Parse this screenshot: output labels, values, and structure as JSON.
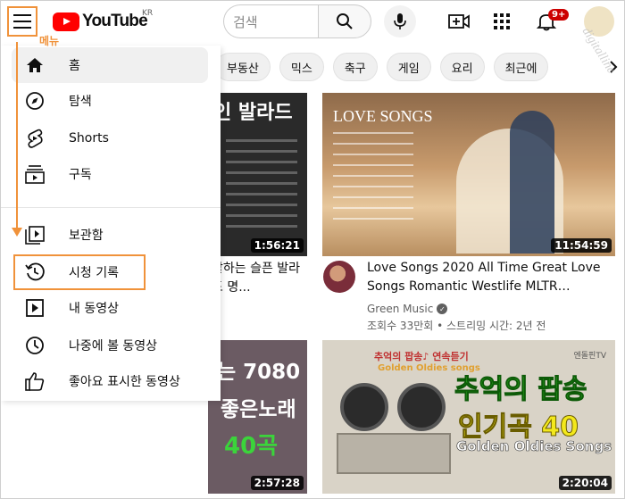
{
  "header": {
    "logo_text": "YouTube",
    "region": "KR",
    "menu_annotation": "메뉴",
    "search_placeholder": "검색",
    "notification_count": "9+",
    "watermark": "digitalline"
  },
  "chips": [
    "부동산",
    "믹스",
    "축구",
    "게임",
    "요리",
    "최근에"
  ],
  "sidebar": {
    "items": [
      {
        "label": "홈",
        "icon": "home-icon"
      },
      {
        "label": "탐색",
        "icon": "compass-icon"
      },
      {
        "label": "Shorts",
        "icon": "shorts-icon"
      },
      {
        "label": "구독",
        "icon": "subscriptions-icon"
      },
      {
        "label": "보관함",
        "icon": "library-icon"
      },
      {
        "label": "시청 기록",
        "icon": "history-icon"
      },
      {
        "label": "내 동영상",
        "icon": "my-videos-icon"
      },
      {
        "label": "나중에 볼 동영상",
        "icon": "watch-later-icon"
      },
      {
        "label": "좋아요 표시한 동영상",
        "icon": "thumbs-up-icon"
      }
    ]
  },
  "videos": [
    {
      "thumb_text": "인 발라드",
      "duration": "1:56:21",
      "title": "할하는 슬픈 발라드 명..."
    },
    {
      "thumb_text": "LOVE SONGS",
      "duration": "11:54:59",
      "title": "Love Songs 2020 All Time Great Love Songs Romantic Westlife MLTR…",
      "channel": "Green Music",
      "meta": "조회수 33만회 • 스트리밍 시간: 2년 전"
    },
    {
      "thumb_text_1": "는 7080",
      "thumb_text_2": "좋은노래",
      "thumb_text_3": "40곡",
      "duration": "2:57:28"
    },
    {
      "thumb_sub": "추억의 팝송♪ 연속듣기",
      "thumb_sub2": "Golden Oldies songs",
      "thumb_tv": "엔돌핀TV",
      "thumb_main": "추억의 팝송",
      "thumb_main2": "인기곡 40",
      "thumb_eng": "Golden Oldies Songs",
      "duration": "2:20:04"
    }
  ],
  "colors": {
    "accent_annotation": "#f0923a",
    "youtube_red": "#ff0000",
    "badge_red": "#cc0000"
  }
}
